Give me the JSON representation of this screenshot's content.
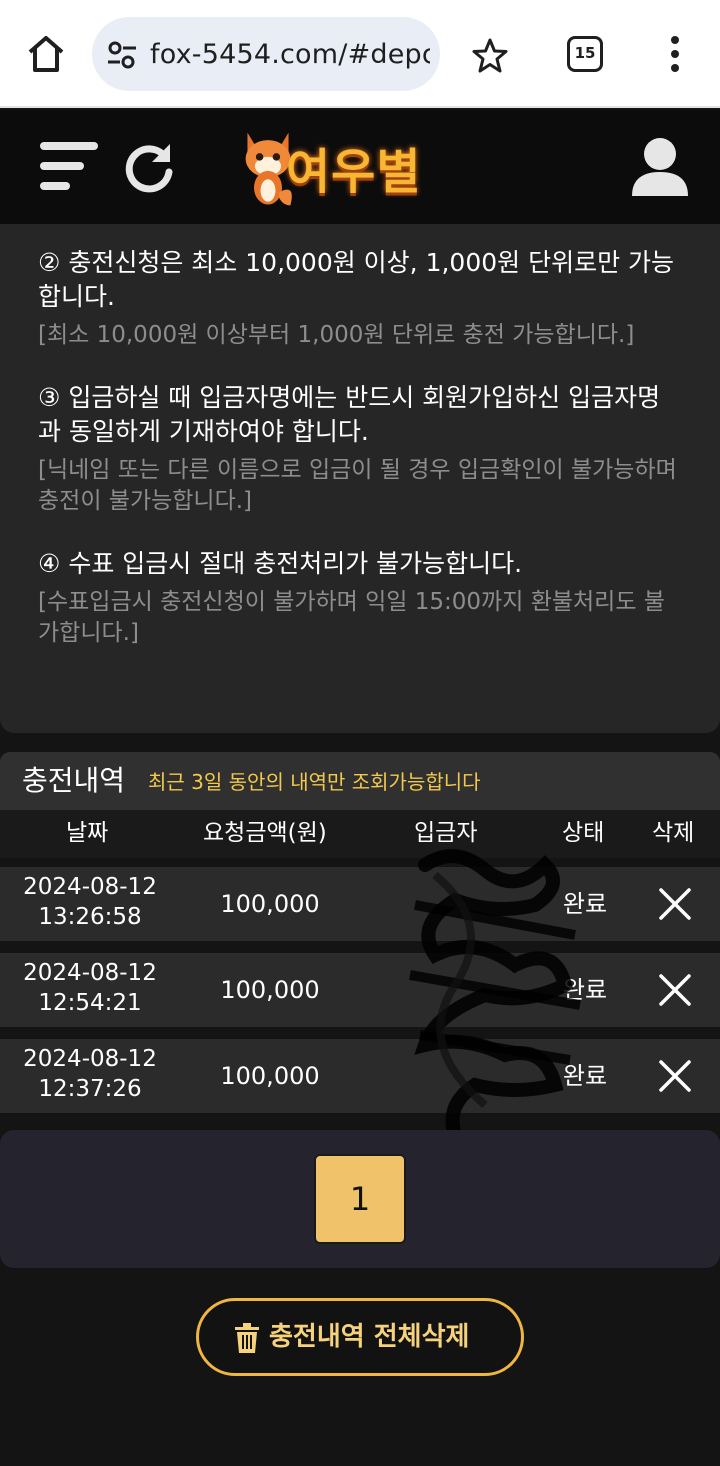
{
  "browser": {
    "url": "fox-5454.com/#depc",
    "tab_count": "15"
  },
  "header": {
    "logo_text": "여우별"
  },
  "notice": {
    "items": [
      {
        "main": "② 충전신청은 최소 10,000원 이상, 1,000원 단위로만 가능합니다.",
        "sub": "[최소 10,000원 이상부터 1,000원 단위로 충전 가능합니다.]"
      },
      {
        "main": "③ 입금하실 때 입금자명에는 반드시 회원가입하신 입금자명과 동일하게 기재하여야 합니다.",
        "sub": "[닉네임 또는 다른 이름으로 입금이 될 경우 입금확인이 불가능하며 충전이 불가능합니다.]"
      },
      {
        "main": "④ 수표 입금시 절대 충전처리가 불가능합니다.",
        "sub": "[수표입금시 충전신청이 불가하며 익일 15:00까지 환불처리도 불가합니다.]"
      }
    ]
  },
  "history": {
    "title": "충전내역",
    "description": "최근 3일 동안의 내역만 조회가능합니다",
    "columns": {
      "date": "날짜",
      "amount": "요청금액(원)",
      "depositor": "입금자",
      "status": "상태",
      "delete": "삭제"
    },
    "rows": [
      {
        "date": "2024-08-12",
        "time": "13:26:58",
        "amount": "100,000",
        "depositor": "",
        "status": "완료"
      },
      {
        "date": "2024-08-12",
        "time": "12:54:21",
        "amount": "100,000",
        "depositor": "",
        "status": "완료"
      },
      {
        "date": "2024-08-12",
        "time": "12:37:26",
        "amount": "100,000",
        "depositor": "",
        "status": "완료"
      }
    ]
  },
  "pagination": {
    "current_page": "1"
  },
  "actions": {
    "delete_all_label": "충전내역 전체삭제"
  },
  "icons": {
    "home": "home-icon",
    "site_settings": "tune-icon",
    "bookmark": "star-icon",
    "menu": "more-vert-icon",
    "hamburger": "hamburger-icon",
    "refresh": "refresh-icon",
    "user": "user-icon",
    "delete_row": "close-icon",
    "trash": "trash-icon"
  },
  "colors": {
    "accent": "#f0c36a",
    "highlight_text": "#f2c94c",
    "button_border": "#f0b640"
  }
}
